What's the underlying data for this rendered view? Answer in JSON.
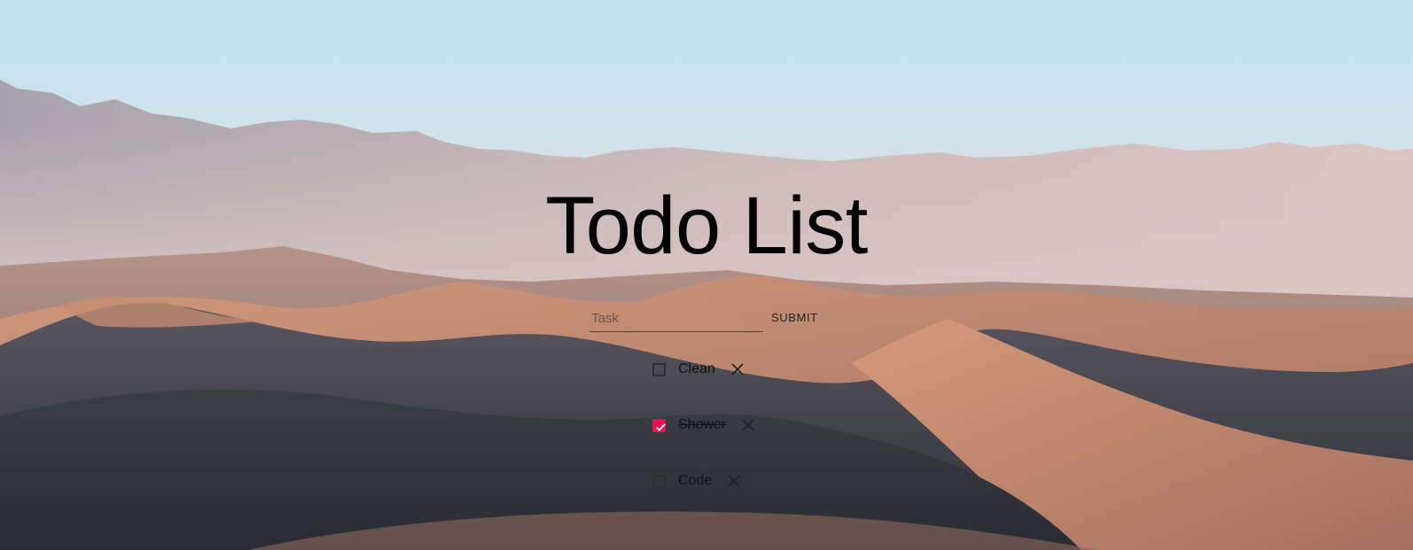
{
  "header": {
    "title": "Todo List"
  },
  "form": {
    "input_value": "",
    "placeholder": "Task",
    "submit_label": "SUBMIT"
  },
  "todos": [
    {
      "label": "Clean",
      "done": false
    },
    {
      "label": "Shower",
      "done": true
    },
    {
      "label": "Code",
      "done": false
    }
  ],
  "colors": {
    "checked_accent": "#ee0f4f",
    "text": "#111111"
  },
  "icons": {
    "delete": "close-icon",
    "check": "checkmark-icon"
  }
}
